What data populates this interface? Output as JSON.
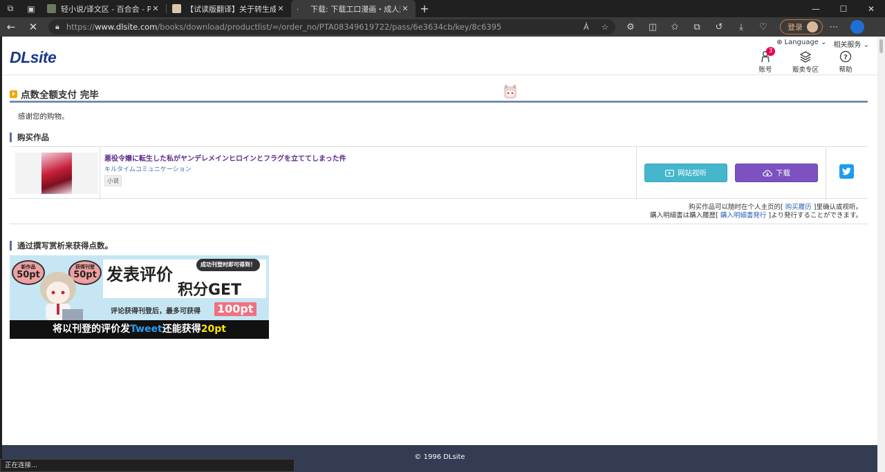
{
  "browser": {
    "tabs": [
      {
        "title": "轻小说/译文区 - 百合会 - Powere",
        "favicon_color": "#6b7a5a",
        "active": false
      },
      {
        "title": "【试读版翻译】关于转生成为反派",
        "favicon_color": "#d8c8a8",
        "active": false
      },
      {
        "title": "下载: 下载工口漫画・成人漫画,",
        "favicon_color": "#ffffff",
        "active": true
      }
    ],
    "url": {
      "scheme": "https://",
      "host": "www.dlsite.com",
      "path": "/books/download/productlist/=/order_no/PTA08349619722/pass/6e3634cb/key/8c6395"
    },
    "login_label": "登录",
    "status_text": "正在连接..."
  },
  "header": {
    "logo": "DLsite",
    "language_label": "Language",
    "services_label": "相关服务",
    "icons": [
      {
        "name": "account",
        "label": "账号",
        "badge": "3"
      },
      {
        "name": "sell",
        "label": "贩卖专区"
      },
      {
        "name": "help",
        "label": "帮助"
      }
    ]
  },
  "main": {
    "page_title": "点数全额支付 完毕",
    "thanks": "感谢您的购物。",
    "purchased_heading": "购买作品",
    "item": {
      "title": "悪役令嬢に転生した私がヤンデレメインヒロインとフラグを立ててしまった件",
      "circle": "キルタイムコミュニケーション",
      "genre": "小说",
      "view_button": "网站视听",
      "download_button": "下载"
    },
    "notes": {
      "line1_pre": "购买作品可以随时在个人主页的[ ",
      "line1_link": "购买履历",
      "line1_post": " ]里确认或视听。",
      "line2_pre": "購入明細書は購入履歴[ ",
      "line2_link": "購入明細書発行",
      "line2_post": " ]より発行することができます。"
    },
    "review_heading": "通过撰写赏析来获得点数。",
    "banner": {
      "new_label": "新作品",
      "new_points": "50pt",
      "earn_label": "获得刊登",
      "earn_points": "50pt",
      "headline1": "发表评价",
      "headline2": "积分GET",
      "bubble": "成功刊登时即可得到！",
      "line2": "评论获得刊登后，最多可获得",
      "max_points": "100pt",
      "bottom_pre": "将以刊登的评价发",
      "bottom_tweet": "Tweet",
      "bottom_mid": "还能获得",
      "bottom_points": "20pt"
    }
  },
  "footer": {
    "copyright": "© 1996 DLsite"
  },
  "colors": {
    "logo": "#1a3a8a",
    "work_title": "#5d2a8a",
    "view_button": "#45b6cc",
    "download_button": "#7b52bf",
    "twitter": "#1d9bf0",
    "footer": "#333c52",
    "badge": "#e5004f"
  }
}
